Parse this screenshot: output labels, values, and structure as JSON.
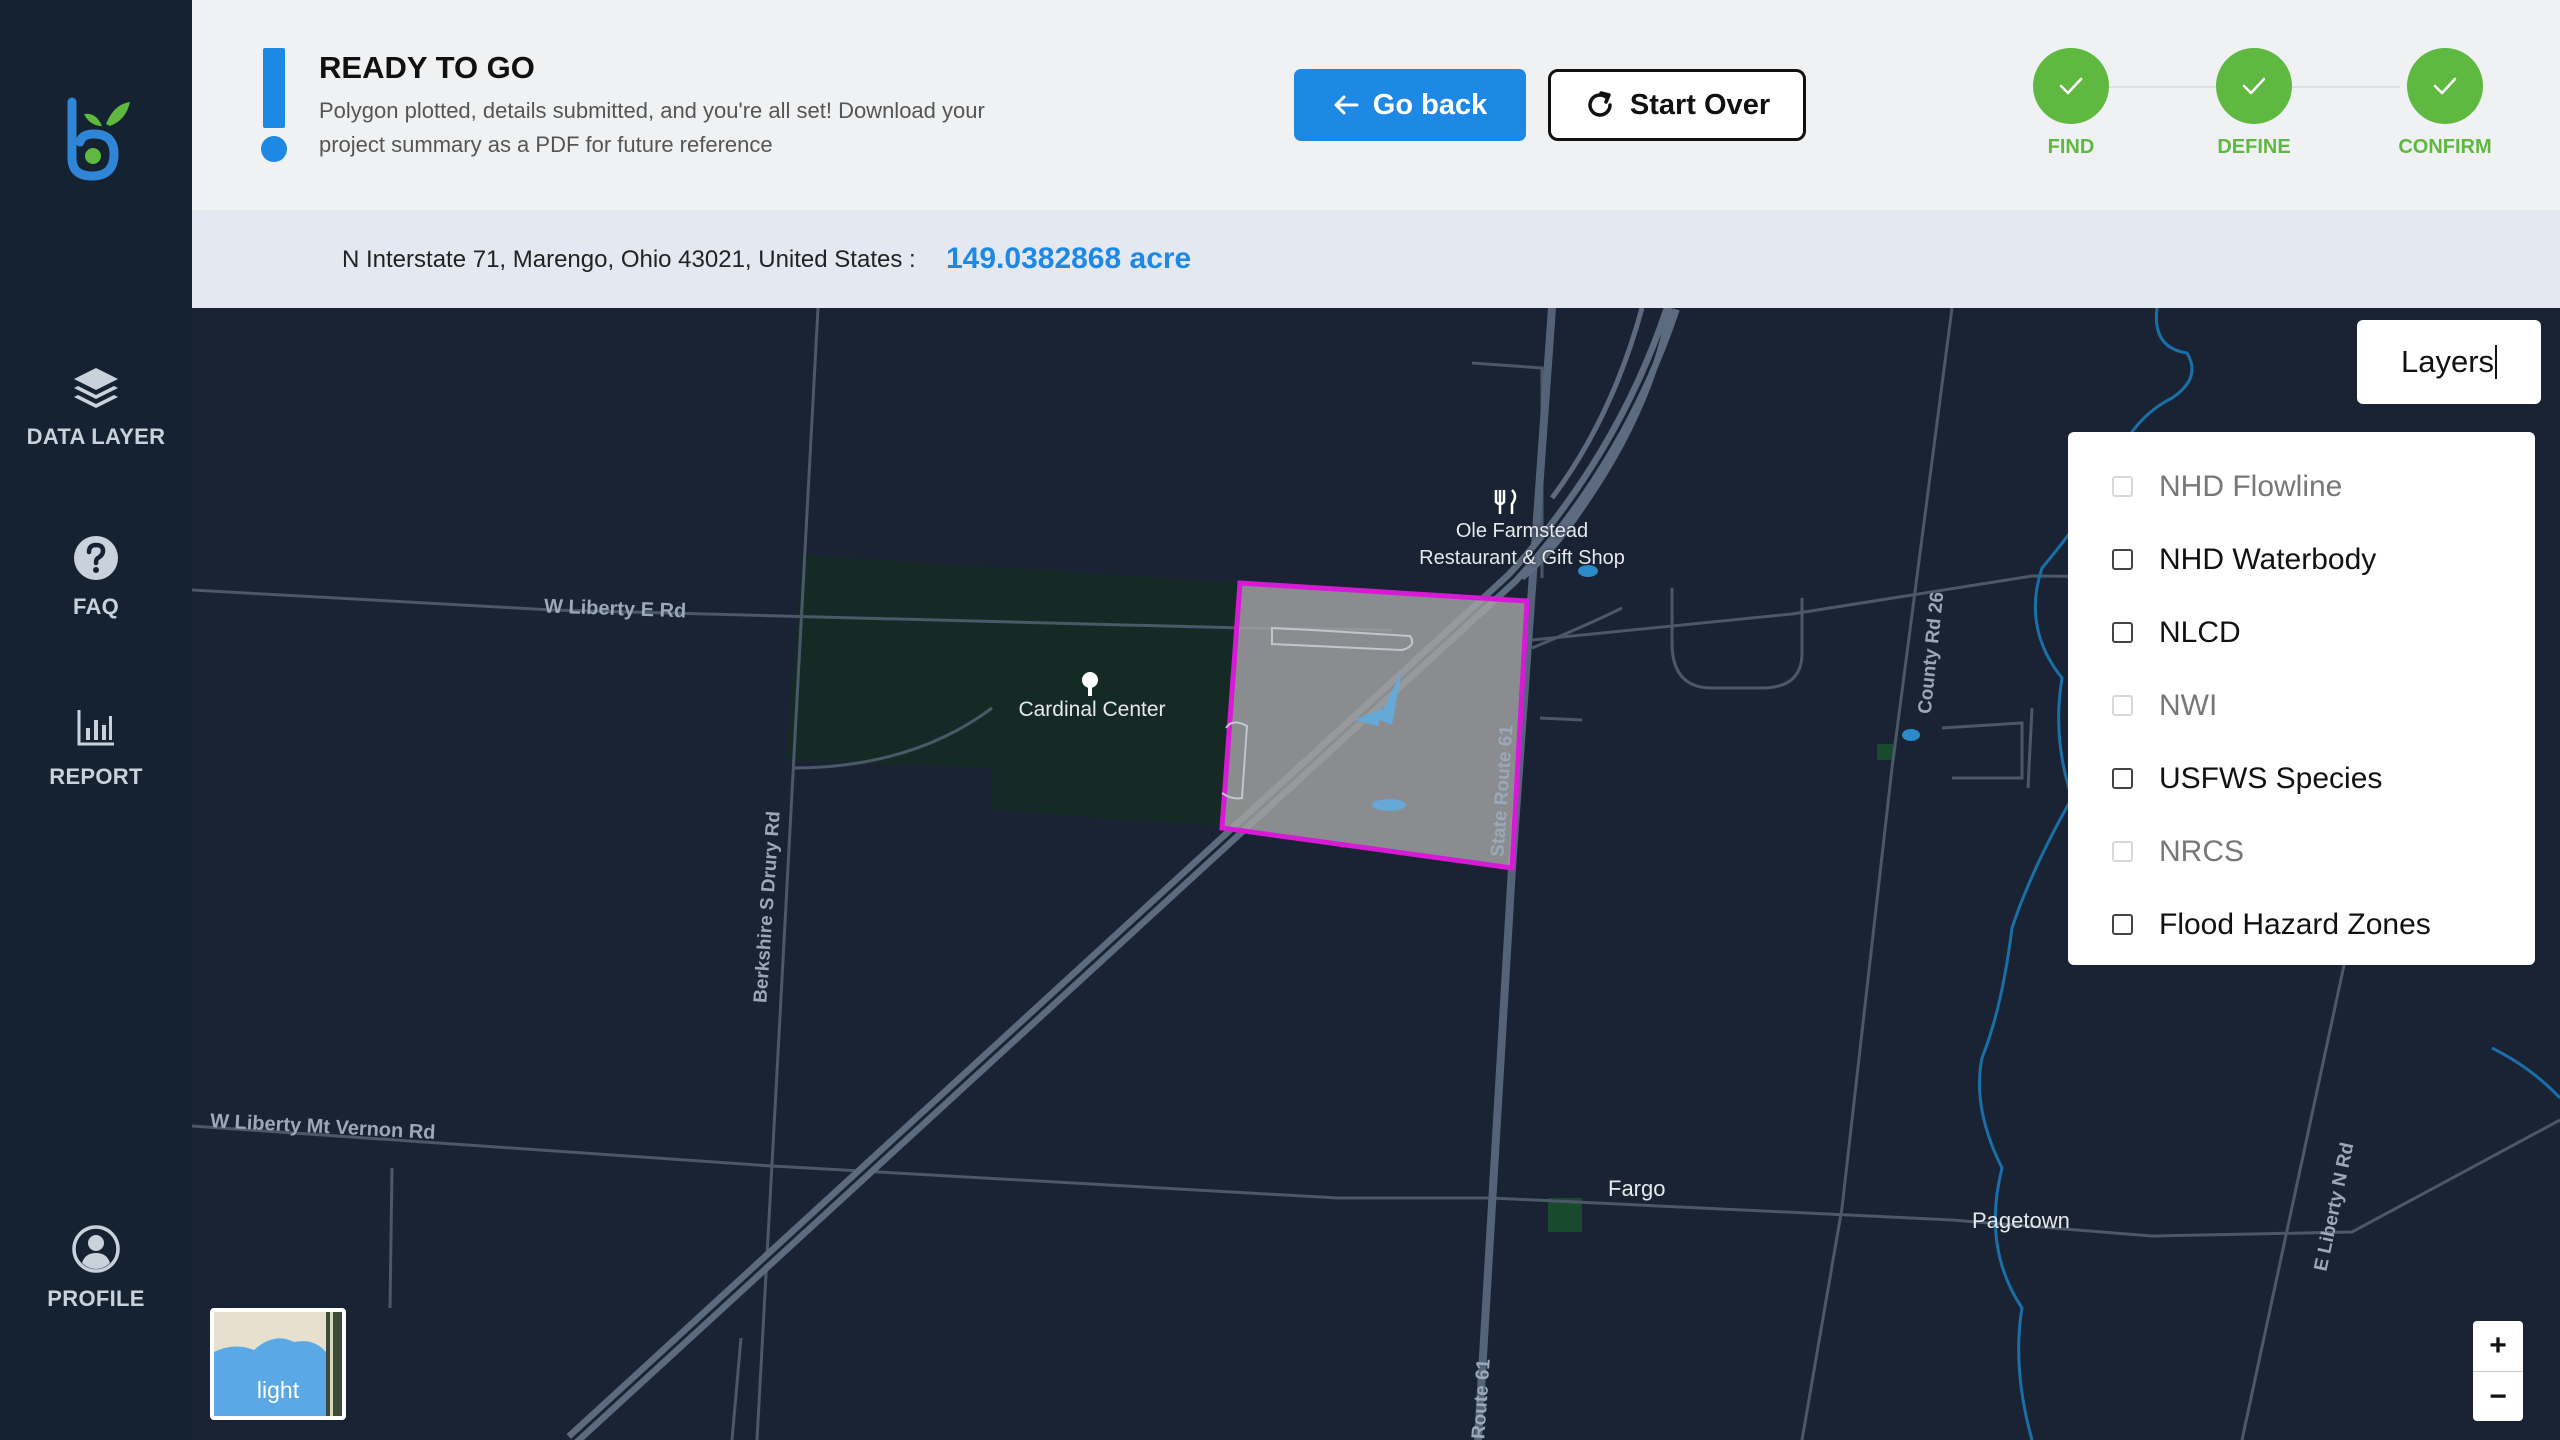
{
  "sidebar": {
    "items": [
      {
        "label": "DATA LAYER",
        "icon": "layers-icon"
      },
      {
        "label": "FAQ",
        "icon": "help-circle-icon"
      },
      {
        "label": "REPORT",
        "icon": "bar-chart-icon"
      },
      {
        "label": "PROFILE",
        "icon": "user-circle-icon"
      }
    ]
  },
  "header": {
    "title": "READY TO GO",
    "description": "Polygon plotted, details submitted, and you're all set! Download your project summary as a PDF for future reference",
    "back_label": "Go back",
    "start_over_label": "Start Over",
    "steps": [
      {
        "label": "FIND",
        "status": "complete"
      },
      {
        "label": "DEFINE",
        "status": "complete"
      },
      {
        "label": "CONFIRM",
        "status": "complete"
      }
    ],
    "accent_color": "#1e88e5",
    "step_color": "#5fb840"
  },
  "address": {
    "text": "N Interstate 71, Marengo, Ohio 43021, United States :",
    "area": "149.0382868 acre"
  },
  "map": {
    "labels": {
      "restaurant_line1": "Ole Farmstead",
      "restaurant_line2": "Restaurant & Gift Shop",
      "cardinal": "Cardinal Center",
      "w_liberty_e": "W Liberty E Rd",
      "berkshire": "Berkshire S Drury Rd",
      "w_liberty_mt": "W Liberty Mt Vernon Rd",
      "state_route": "State Route 61",
      "route61": "Route 61",
      "county26": "County Rd 26",
      "e_liberty": "E Liberty N Rd",
      "fargo": "Fargo",
      "pagetown": "Pagetown"
    },
    "polygon_color": "#d61ad6",
    "layers_button": "Layers",
    "layers": [
      {
        "label": "NHD Flowline",
        "enabled": false
      },
      {
        "label": "NHD Waterbody",
        "enabled": true
      },
      {
        "label": "NLCD",
        "enabled": true
      },
      {
        "label": "NWI",
        "enabled": false
      },
      {
        "label": "USFWS Species",
        "enabled": true
      },
      {
        "label": "NRCS",
        "enabled": false
      },
      {
        "label": "Flood Hazard Zones",
        "enabled": true
      }
    ],
    "basemap_label": "light",
    "zoom_in": "+",
    "zoom_out": "−"
  }
}
